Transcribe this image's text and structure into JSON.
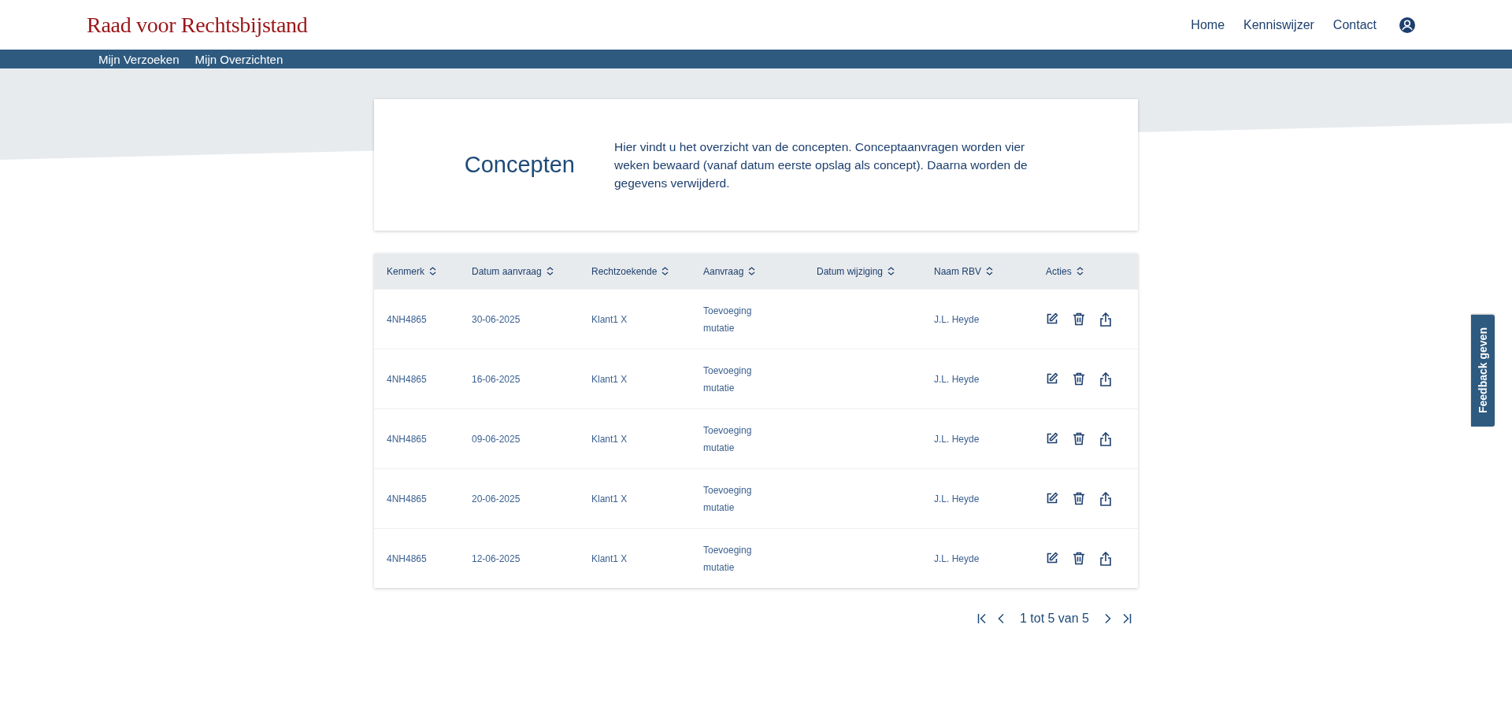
{
  "header": {
    "logo": "Raad voor Rechtsbijstand",
    "nav": [
      "Home",
      "Kenniswijzer",
      "Contact"
    ]
  },
  "subnav": [
    "Mijn Verzoeken",
    "Mijn Overzichten"
  ],
  "intro": {
    "title": "Concepten",
    "text": "Hier vindt u het overzicht van de concepten. Conceptaanvragen worden vier weken bewaard (vanaf datum eerste opslag als concept). Daarna worden de gegevens verwijderd."
  },
  "table": {
    "columns": [
      "Kenmerk",
      "Datum aanvraag",
      "Rechtzoekende",
      "Aanvraag",
      "Datum wijziging",
      "Naam RBV",
      "Acties"
    ],
    "rows": [
      {
        "kenmerk": "4NH4865",
        "datum_aanvraag": "30-06-2025",
        "rechtzoekende": "Klant1 X",
        "aanvraag": "Toevoeging mutatie",
        "naam_rbv": "J.L. Heyde"
      },
      {
        "kenmerk": "4NH4865",
        "datum_aanvraag": "16-06-2025",
        "rechtzoekende": "Klant1 X",
        "aanvraag": "Toevoeging mutatie",
        "naam_rbv": "J.L. Heyde"
      },
      {
        "kenmerk": "4NH4865",
        "datum_aanvraag": "09-06-2025",
        "rechtzoekende": "Klant1 X",
        "aanvraag": "Toevoeging mutatie",
        "naam_rbv": "J.L. Heyde"
      },
      {
        "kenmerk": "4NH4865",
        "datum_aanvraag": "20-06-2025",
        "rechtzoekende": "Klant1 X",
        "aanvraag": "Toevoeging mutatie",
        "naam_rbv": "J.L. Heyde"
      },
      {
        "kenmerk": "4NH4865",
        "datum_aanvraag": "12-06-2025",
        "rechtzoekende": "Klant1 X",
        "aanvraag": "Toevoeging mutatie",
        "naam_rbv": "J.L. Heyde"
      }
    ]
  },
  "pagination": {
    "label": "1 tot 5 van 5"
  },
  "feedback": {
    "label": "Feedback geven"
  }
}
